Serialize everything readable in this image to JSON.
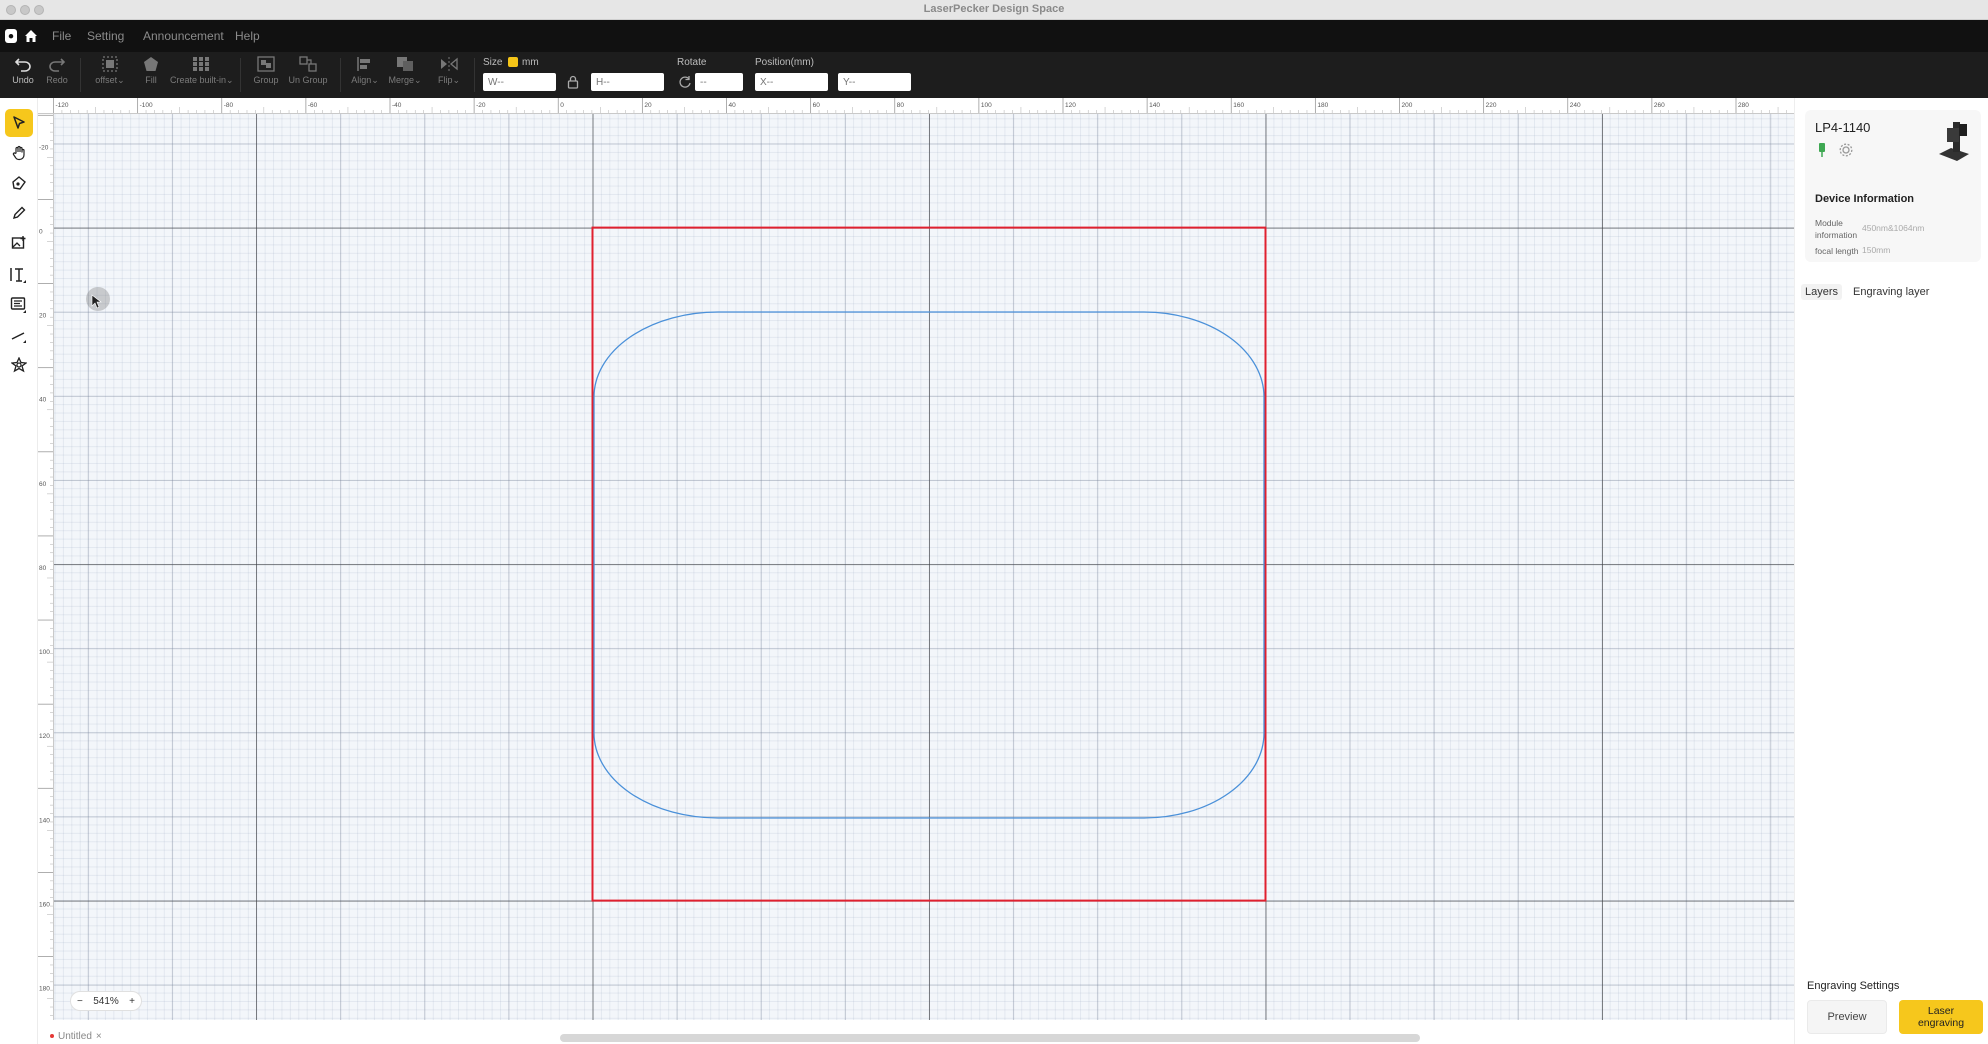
{
  "window": {
    "title": "LaserPecker Design Space"
  },
  "menu": {
    "items": [
      "File",
      "Setting",
      "Announcement",
      "Help"
    ]
  },
  "toolbar": {
    "undo": "Undo",
    "redo": "Redo",
    "offset": "offset",
    "fill": "Fill",
    "create_built_in": "Create built-in",
    "group": "Group",
    "ungroup": "Un Group",
    "align": "Align",
    "merge": "Merge",
    "flip": "Flip",
    "size_label": "Size",
    "unit": "mm",
    "width_placeholder": "W--",
    "height_placeholder": "H--",
    "rotate_label": "Rotate",
    "rotate_placeholder": "--",
    "position_label": "Position(mm)",
    "x_placeholder": "X--",
    "y_placeholder": "Y--"
  },
  "left_tools": [
    "select-tool",
    "hand-tool",
    "pen-tool",
    "pencil-tool",
    "image-tool",
    "text-tool",
    "barcode-tool",
    "line-tool",
    "shape-tool"
  ],
  "rulers": {
    "top": [
      "-120",
      "-100",
      "-80",
      "-60",
      "-40",
      "-20",
      "0",
      "20",
      "40",
      "60",
      "80",
      "100",
      "120",
      "140",
      "160",
      "180",
      "200",
      "220",
      "240",
      "260",
      "280"
    ],
    "left": [
      "-20",
      "0",
      "20",
      "40",
      "60",
      "80",
      "100",
      "120",
      "140",
      "160",
      "180"
    ]
  },
  "canvas": {
    "work_area_color": "#e0202f",
    "shape_stroke_color": "#4a90d9"
  },
  "zoom": {
    "minus": "−",
    "value": "541%",
    "plus": "+"
  },
  "document_tab": {
    "name": "Untitled",
    "close": "×"
  },
  "device": {
    "name": "LP4-1140",
    "info_title": "Device Information",
    "module_label": "Module information",
    "module_value": "450nm&1064nm",
    "focal_label": "focal length",
    "focal_value": "150mm"
  },
  "panel_tabs": [
    "Layers",
    "Engraving layer"
  ],
  "engraving": {
    "title": "Engraving Settings",
    "preview": "Preview",
    "laser": "Laser engraving"
  },
  "colors": {
    "accent": "#f6c71c",
    "menubar": "#111111",
    "toolbar": "#1d1d1d"
  }
}
